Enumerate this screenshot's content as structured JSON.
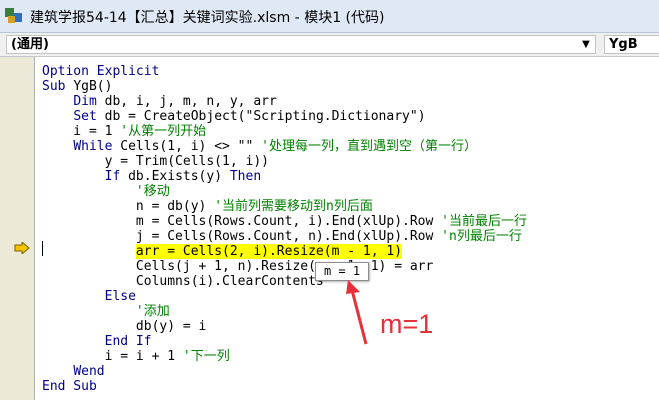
{
  "window": {
    "title": "建筑学报54-14【汇总】关键词实验.xlsm - 模块1 (代码)"
  },
  "toolbar": {
    "object_combo": "(通用)",
    "procedure_combo": "YgB",
    "dropdown_glyph": "▼"
  },
  "code": {
    "lines": [
      [
        [
          "kw",
          "Option Explicit"
        ]
      ],
      [
        [
          "kw",
          "Sub "
        ],
        [
          "",
          "YgB()"
        ]
      ],
      [
        [
          "",
          "    "
        ],
        [
          "kw",
          "Dim"
        ],
        [
          "",
          " db, i, j, m, n, y, arr"
        ]
      ],
      [
        [
          "",
          "    "
        ],
        [
          "kw",
          "Set"
        ],
        [
          "",
          " db = CreateObject(\"Scripting.Dictionary\")"
        ]
      ],
      [
        [
          "",
          "    i = 1 "
        ],
        [
          "cm",
          "'从第一列开始"
        ]
      ],
      [
        [
          "",
          "    "
        ],
        [
          "kw",
          "While"
        ],
        [
          "",
          " Cells(1, i) <> \"\" "
        ],
        [
          "cm",
          "'处理每一列，直到遇到空（第一行）"
        ]
      ],
      [
        [
          "",
          "        y = Trim(Cells(1, i))"
        ]
      ],
      [
        [
          "",
          "        "
        ],
        [
          "kw",
          "If"
        ],
        [
          "",
          " db.Exists(y) "
        ],
        [
          "kw",
          "Then"
        ]
      ],
      [
        [
          "",
          "            "
        ],
        [
          "cm",
          "'移动"
        ]
      ],
      [
        [
          "",
          "            n = db(y) "
        ],
        [
          "cm",
          "'当前列需要移动到n列后面"
        ]
      ],
      [
        [
          "",
          "            m = Cells(Rows.Count, i).End(xlUp).Row "
        ],
        [
          "cm",
          "'当前最后一行"
        ]
      ],
      [
        [
          "",
          "            j = Cells(Rows.Count, n).End(xlUp).Row "
        ],
        [
          "cm",
          "'n列最后一行"
        ]
      ],
      [
        [
          "",
          "            "
        ],
        [
          "hl",
          "arr = Cells(2, i).Resize(m - 1, 1)"
        ]
      ],
      [
        [
          "",
          "            Cells(j + 1, n).Resize(m - 1, 1) = arr"
        ]
      ],
      [
        [
          "",
          "            Columns(i).ClearContents"
        ]
      ],
      [
        [
          "",
          "        "
        ],
        [
          "kw",
          "Else"
        ]
      ],
      [
        [
          "",
          "            "
        ],
        [
          "cm",
          "'添加"
        ]
      ],
      [
        [
          "",
          "            db(y) = i"
        ]
      ],
      [
        [
          "",
          "        "
        ],
        [
          "kw",
          "End If"
        ]
      ],
      [
        [
          "",
          "        i = i + 1 "
        ],
        [
          "cm",
          "'下一列"
        ]
      ],
      [
        [
          "",
          "    "
        ],
        [
          "kw",
          "Wend"
        ]
      ],
      [
        [
          "kw",
          "End Sub"
        ]
      ]
    ]
  },
  "tooltip": {
    "text": "m = 1"
  },
  "annotation": {
    "text": "m=1",
    "color": "#e8303a"
  },
  "colors": {
    "keyword": "#00008b",
    "comment": "#008000",
    "highlight": "#ffff00",
    "exec_arrow": "#f5c400"
  }
}
